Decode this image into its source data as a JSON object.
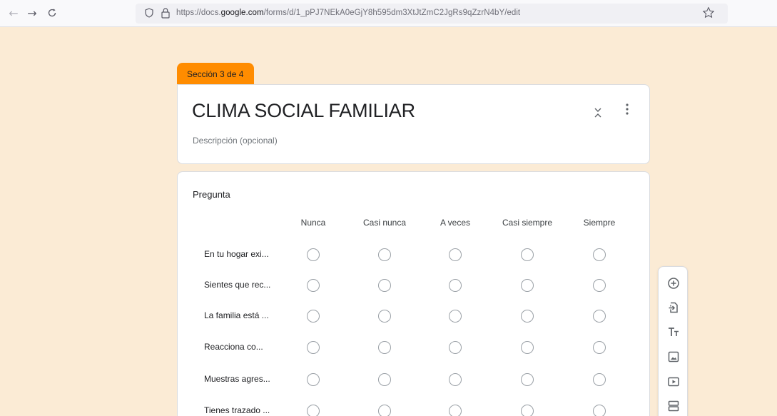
{
  "browser": {
    "url_prefix": "https://docs.",
    "url_domain": "google.com",
    "url_path": "/forms/d/1_pPJ7NEkA0eGjY8h595dm3XtJtZmC2JgRs9qZzrN4bY/edit",
    "icons": [
      "back-icon",
      "forward-icon",
      "reload-icon",
      "shield-icon",
      "lock-icon",
      "star-icon"
    ]
  },
  "section": {
    "tag": "Sección 3 de 4",
    "title": "CLIMA SOCIAL FAMILIAR",
    "description_placeholder": "Descripción (opcional)"
  },
  "question": {
    "label": "Pregunta",
    "columns": [
      "Nunca",
      "Casi nunca",
      "A veces",
      "Casi siempre",
      "Siempre"
    ],
    "rows": [
      "En tu hogar exi...",
      "Sientes que rec...",
      "La familia está ...",
      "Reacciona co...",
      "Muestras agres...",
      "Tienes trazado ..."
    ]
  },
  "side_toolbar": {
    "icons": [
      "add-question-icon",
      "import-questions-icon",
      "add-title-icon",
      "add-image-icon",
      "add-video-icon",
      "add-section-icon"
    ]
  },
  "colors": {
    "page_background": "#fbebd5",
    "section_tag": "#ff8c00"
  }
}
